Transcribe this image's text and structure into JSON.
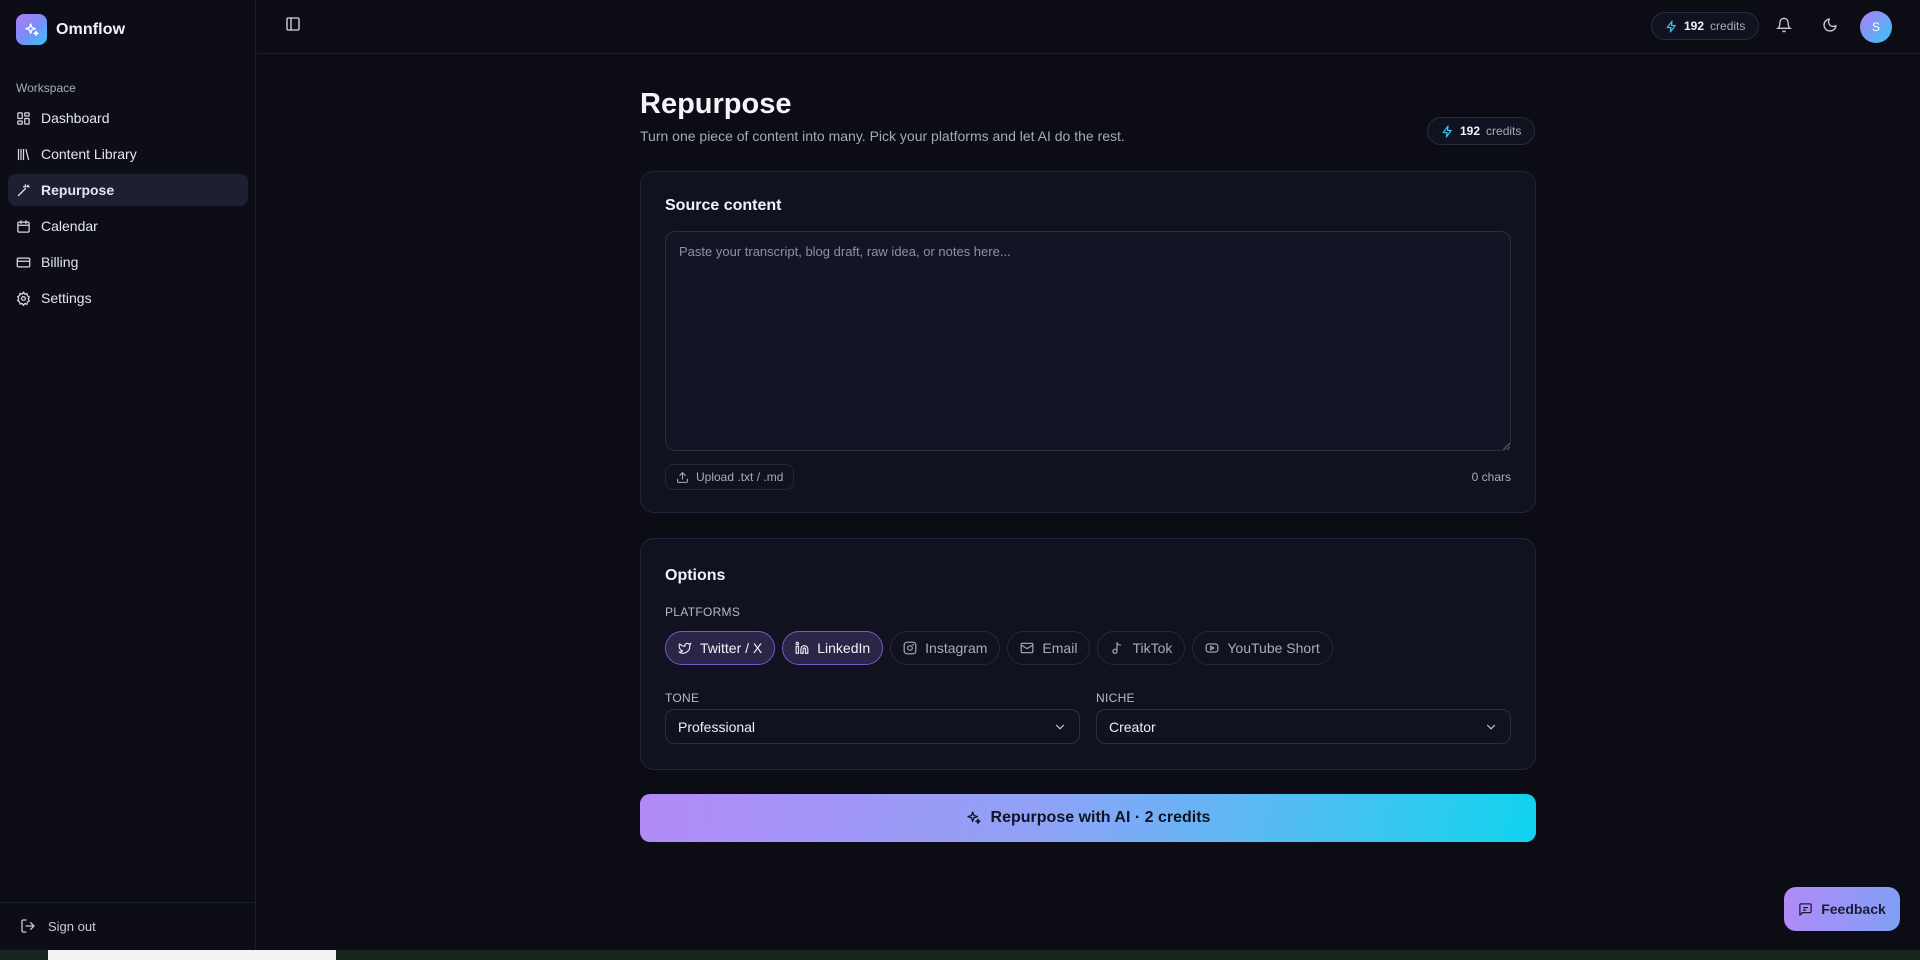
{
  "app": {
    "name": "Omnflow"
  },
  "sidebar": {
    "section_label": "Workspace",
    "items": [
      {
        "label": "Dashboard",
        "icon": "dashboard-icon",
        "active": false
      },
      {
        "label": "Content Library",
        "icon": "library-icon",
        "active": false
      },
      {
        "label": "Repurpose",
        "icon": "wand-icon",
        "active": true
      },
      {
        "label": "Calendar",
        "icon": "calendar-icon",
        "active": false
      },
      {
        "label": "Billing",
        "icon": "credit-card-icon",
        "active": false
      },
      {
        "label": "Settings",
        "icon": "gear-icon",
        "active": false
      }
    ],
    "sign_out_label": "Sign out"
  },
  "topbar": {
    "credits_count": "192",
    "credits_label": "credits",
    "avatar_initial": "S"
  },
  "page": {
    "title": "Repurpose",
    "subtitle": "Turn one piece of content into many. Pick your platforms and let AI do the rest.",
    "credits_count": "192",
    "credits_label": "credits"
  },
  "source": {
    "title": "Source content",
    "placeholder": "Paste your transcript, blog draft, raw idea, or notes here...",
    "value": "",
    "upload_label": "Upload .txt / .md",
    "char_count": "0 chars"
  },
  "options": {
    "title": "Options",
    "platforms_label": "PLATFORMS",
    "platforms": [
      {
        "label": "Twitter / X",
        "icon": "twitter-icon",
        "selected": true
      },
      {
        "label": "LinkedIn",
        "icon": "linkedin-icon",
        "selected": true
      },
      {
        "label": "Instagram",
        "icon": "instagram-icon",
        "selected": false
      },
      {
        "label": "Email",
        "icon": "mail-icon",
        "selected": false
      },
      {
        "label": "TikTok",
        "icon": "music-note-icon",
        "selected": false
      },
      {
        "label": "YouTube Short",
        "icon": "youtube-icon",
        "selected": false
      }
    ],
    "tone_label": "TONE",
    "tone_value": "Professional",
    "niche_label": "NICHE",
    "niche_value": "Creator"
  },
  "cta": {
    "label": "Repurpose with AI · 2 credits"
  },
  "feedback": {
    "label": "Feedback"
  },
  "colors": {
    "background": "#0b0c14",
    "card": "#111220",
    "accent_purple": "#b38af7",
    "accent_cyan": "#0fd3ee",
    "chip_selected_border": "#7656c8"
  }
}
